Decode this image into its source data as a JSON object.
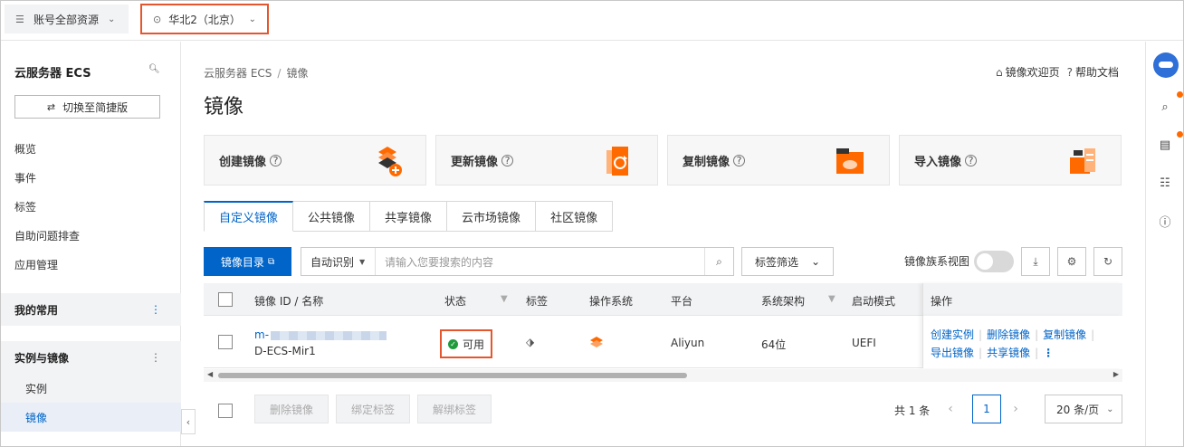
{
  "topbar": {
    "account_label": "账号全部资源",
    "region_label": "华北2（北京）"
  },
  "sidebar": {
    "title": "云服务器 ECS",
    "switch_label": "切换至简捷版",
    "items": [
      "概览",
      "事件",
      "标签",
      "自助问题排查",
      "应用管理"
    ],
    "group_favorites": "我的常用",
    "group_instances": "实例与镜像",
    "sub_items": [
      "实例",
      "镜像"
    ]
  },
  "header": {
    "breadcrumb": [
      "云服务器 ECS",
      "镜像"
    ],
    "welcome_link": "镜像欢迎页",
    "help_link": "帮助文档",
    "title": "镜像"
  },
  "cards": [
    "创建镜像",
    "更新镜像",
    "复制镜像",
    "导入镜像"
  ],
  "tabs": [
    "自定义镜像",
    "公共镜像",
    "共享镜像",
    "云市场镜像",
    "社区镜像"
  ],
  "toolbar": {
    "catalog_button": "镜像目录",
    "search_mode": "自动识别",
    "search_placeholder": "请输入您要搜索的内容",
    "tag_filter": "标签筛选",
    "family_view_label": "镜像族系视图"
  },
  "table": {
    "columns": [
      "镜像 ID / 名称",
      "状态",
      "标签",
      "操作系统",
      "平台",
      "系统架构",
      "启动模式",
      "操作"
    ],
    "rows": [
      {
        "id_prefix": "m-",
        "name": "D-ECS-Mir1",
        "status": "可用",
        "platform": "Aliyun",
        "arch": "64位",
        "boot_mode": "UEFI",
        "actions_line1": [
          "创建实例",
          "删除镜像",
          "复制镜像"
        ],
        "actions_line2": [
          "导出镜像",
          "共享镜像"
        ]
      }
    ]
  },
  "footer": {
    "buttons": [
      "删除镜像",
      "绑定标签",
      "解绑标签"
    ],
    "total": "共 1 条",
    "current_page": "1",
    "page_size": "20 条/页"
  },
  "colors": {
    "brand": "#0064c8",
    "highlight": "#e4572e",
    "success": "#1f9b3c",
    "icon_orange": "#ff6a00"
  }
}
